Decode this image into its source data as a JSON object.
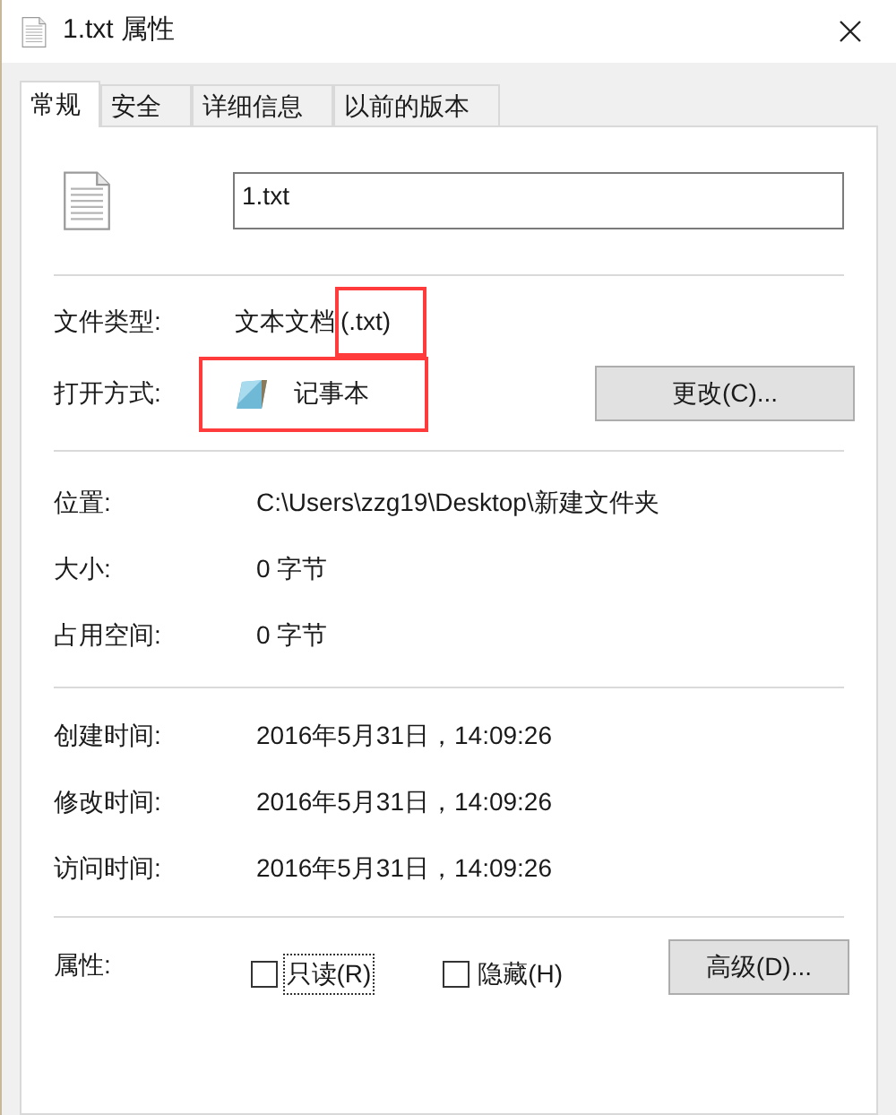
{
  "window": {
    "title": "1.txt 属性"
  },
  "tabs": [
    {
      "label": "常规",
      "selected": true
    },
    {
      "label": "安全",
      "selected": false
    },
    {
      "label": "详细信息",
      "selected": false
    },
    {
      "label": "以前的版本",
      "selected": false
    }
  ],
  "file_name": {
    "value": "1.txt"
  },
  "type_section": {
    "file_type": {
      "label": "文件类型:",
      "value": "文本文档",
      "suffix": "(.txt)",
      "suffix_highlighted": true
    },
    "open_with": {
      "label": "打开方式:",
      "app": "记事本",
      "highlighted": true,
      "button": "更改(C)..."
    }
  },
  "info_rows": [
    {
      "label": "位置:",
      "value": "C:\\Users\\zzg19\\Desktop\\新建文件夹"
    },
    {
      "label": "大小:",
      "value": "0 字节"
    },
    {
      "label": "占用空间:",
      "value": "0 字节"
    }
  ],
  "time_rows": [
    {
      "label": "创建时间:",
      "value": "2016年5月31日，14:09:26"
    },
    {
      "label": "修改时间:",
      "value": "2016年5月31日，14:09:26"
    },
    {
      "label": "访问时间:",
      "value": "2016年5月31日，14:09:26"
    }
  ],
  "attributes": {
    "label": "属性:",
    "checkboxes": [
      {
        "label": "只读(R)",
        "checked": false,
        "focused": true
      },
      {
        "label": "隐藏(H)",
        "checked": false,
        "focused": false
      }
    ],
    "button": "高级(D)..."
  }
}
